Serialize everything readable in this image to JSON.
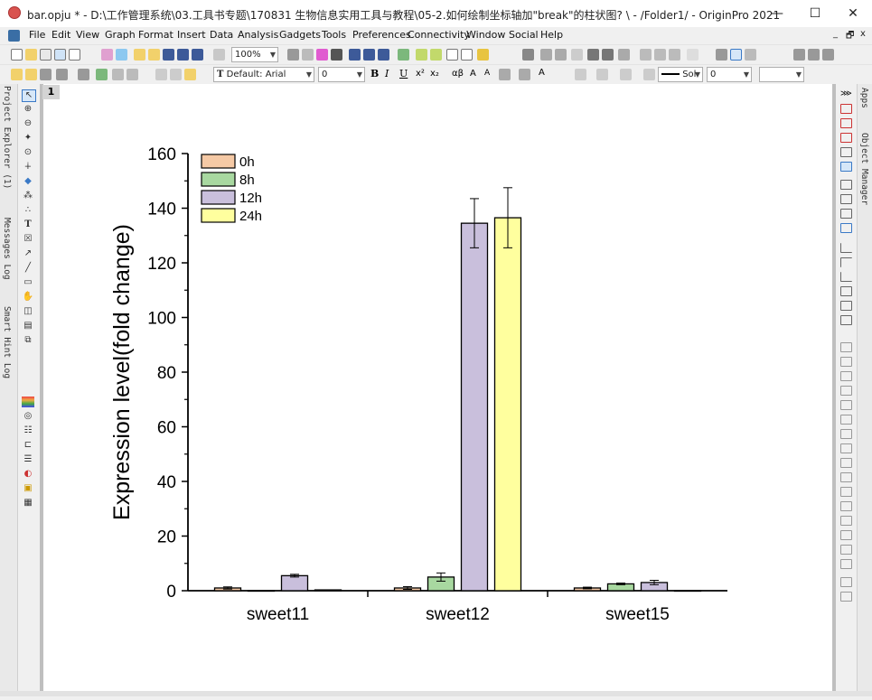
{
  "window": {
    "title": "bar.opju * - D:\\工作管理系统\\03.工具书专题\\170831 生物信息实用工具与教程\\05-2.如何绘制坐标轴加\"break\"的柱状图? \\ - /Folder1/ - OriginPro 2021",
    "minimize": "—",
    "maximize": "☐",
    "close": "✕"
  },
  "menu": {
    "items": [
      "File",
      "Edit",
      "View",
      "Graph",
      "Format",
      "Insert",
      "Data",
      "Analysis",
      "Gadgets",
      "Tools",
      "Preferences",
      "Connectivity",
      "Window",
      "Social",
      "Help"
    ],
    "mdi_controls": [
      "_",
      "🗗",
      "x"
    ]
  },
  "toolbar": {
    "zoom": "100%",
    "font": "Default: Arial",
    "font_size": "0",
    "line_style": "Sol",
    "line_width": "0"
  },
  "left_panel": {
    "tabs": [
      "Project Explorer (1)",
      "Messages Log",
      "Smart Hint Log"
    ]
  },
  "right_panel": {
    "tabs": [
      "Apps",
      "Object Manager"
    ]
  },
  "graph": {
    "layer_number": "1"
  },
  "chart_data": {
    "type": "bar",
    "categories": [
      "sweet11",
      "sweet12",
      "sweet15"
    ],
    "series": [
      {
        "name": "0h",
        "color": "#f5c9a5",
        "values": [
          1.0,
          1.0,
          1.0
        ],
        "errors": [
          0.4,
          0.5,
          0.3
        ]
      },
      {
        "name": "8h",
        "color": "#a8d8a0",
        "values": [
          0,
          5.0,
          2.5
        ],
        "errors": [
          0,
          1.5,
          0.3
        ]
      },
      {
        "name": "12h",
        "color": "#c9bfdc",
        "values": [
          5.5,
          134.5,
          3.0
        ],
        "errors": [
          0.5,
          9.0,
          0.8
        ]
      },
      {
        "name": "24h",
        "color": "#ffff9e",
        "values": [
          0.3,
          136.5,
          0
        ],
        "errors": [
          0,
          11.0,
          0
        ]
      }
    ],
    "ylabel": "Expression level(fold change)",
    "xlabel": "",
    "ylim": [
      0,
      160
    ],
    "yticks": [
      "0",
      "20",
      "40",
      "60",
      "80",
      "100",
      "120",
      "140",
      "160"
    ],
    "legend_position": "top-left",
    "grid": false
  }
}
